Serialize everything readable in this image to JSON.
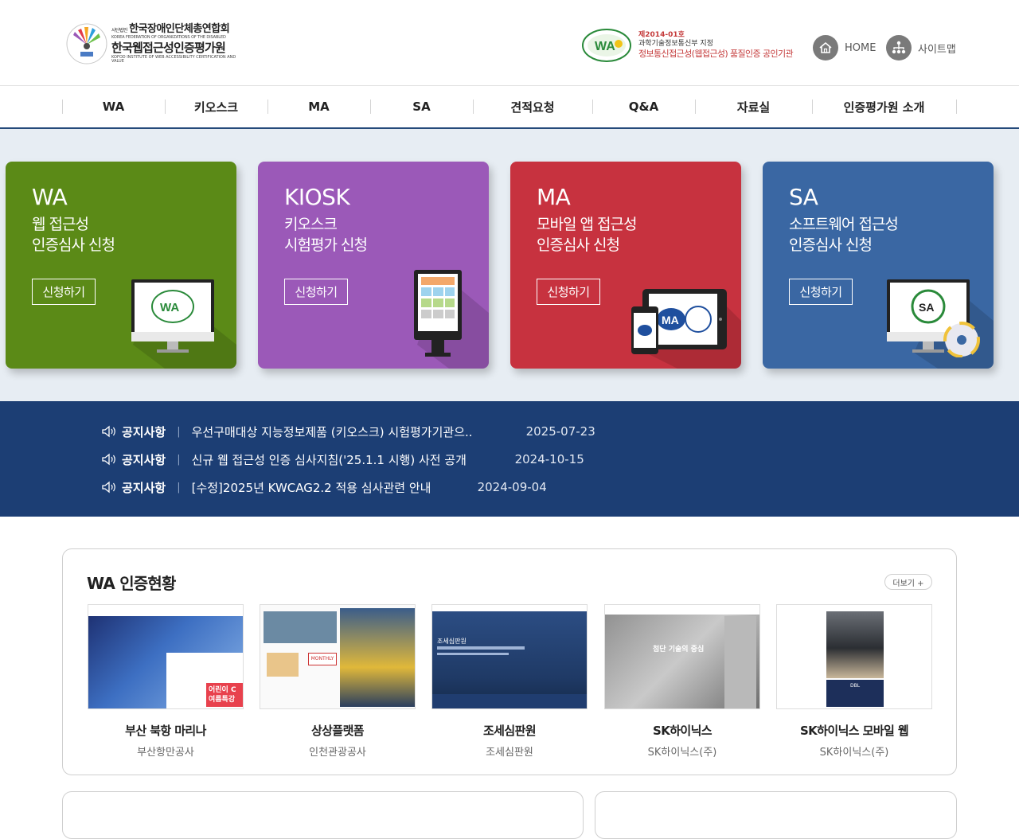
{
  "header": {
    "logo": {
      "line1_small": "사단법인",
      "line1": "한국장애인단체총연합회",
      "line2": "KOREA FEDERATION OF ORGANIZATIONS OF THE DISABLED",
      "line3": "한국웹접근성인증평가원",
      "line4": "KOFOD INSTITUTE OF WEB ACCESSIBILITY CERTIFICATION AND VALUE"
    },
    "cert": {
      "line1": "제2014-01호",
      "line2": "과학기술정보통신부 지정",
      "line3": "정보통신접근성(웹접근성) 품질인증 공인기관"
    },
    "home_label": "HOME",
    "sitemap_label": "사이트맵"
  },
  "nav": [
    "WA",
    "키오스크",
    "MA",
    "SA",
    "견적요청",
    "Q&A",
    "자료실",
    "인증평가원 소개"
  ],
  "hero": {
    "cards": [
      {
        "title": "WA",
        "sub": "웹 접근성\n인증심사 신청",
        "button": "신청하기",
        "color": "#5b8a17"
      },
      {
        "title": "KIOSK",
        "sub": "키오스크\n시험평가 신청",
        "button": "신청하기",
        "color": "#9b59b8"
      },
      {
        "title": "MA",
        "sub": "모바일 앱 접근성\n인증심사 신청",
        "button": "신청하기",
        "color": "#c7323f"
      },
      {
        "title": "SA",
        "sub": "소프트웨어 접근성\n인증심사 신청",
        "button": "신청하기",
        "color": "#3a67a3"
      }
    ]
  },
  "notices": [
    {
      "category": "공지사항",
      "title": "우선구매대상 지능정보제품 (키오스크) 시험평가기관으..",
      "date": "2025-07-23"
    },
    {
      "category": "공지사항",
      "title": "신규 웹 접근성 인증 심사지침('25.1.1 시행) 사전 공개",
      "date": "2024-10-15"
    },
    {
      "category": "공지사항",
      "title": "[수정]2025년 KWCAG2.2 적용 심사관련 안내",
      "date": "2024-09-04"
    }
  ],
  "wa_status": {
    "title": "WA 인증현황",
    "more": "더보기 +",
    "items": [
      {
        "name": "부산 북항 마리나",
        "org": "부산항만공사",
        "thumb_text": "어린이 C 여름특강"
      },
      {
        "name": "상상플랫폼",
        "org": "인천관광공사",
        "thumb_text": "MONTHLY"
      },
      {
        "name": "조세심판원",
        "org": "조세심판원",
        "thumb_text": "조세심판원"
      },
      {
        "name": "SK하이닉스",
        "org": "SK하이닉스(주)",
        "thumb_text": "첨단 기술의 중심"
      },
      {
        "name": "SK하이닉스 모바일 웹",
        "org": "SK하이닉스(주)",
        "thumb_text": "DBL"
      }
    ]
  },
  "colors": {
    "nav_border": "#244a7a",
    "hero_bg": "#e7edf3",
    "notice_bg": "#1c3e74"
  }
}
